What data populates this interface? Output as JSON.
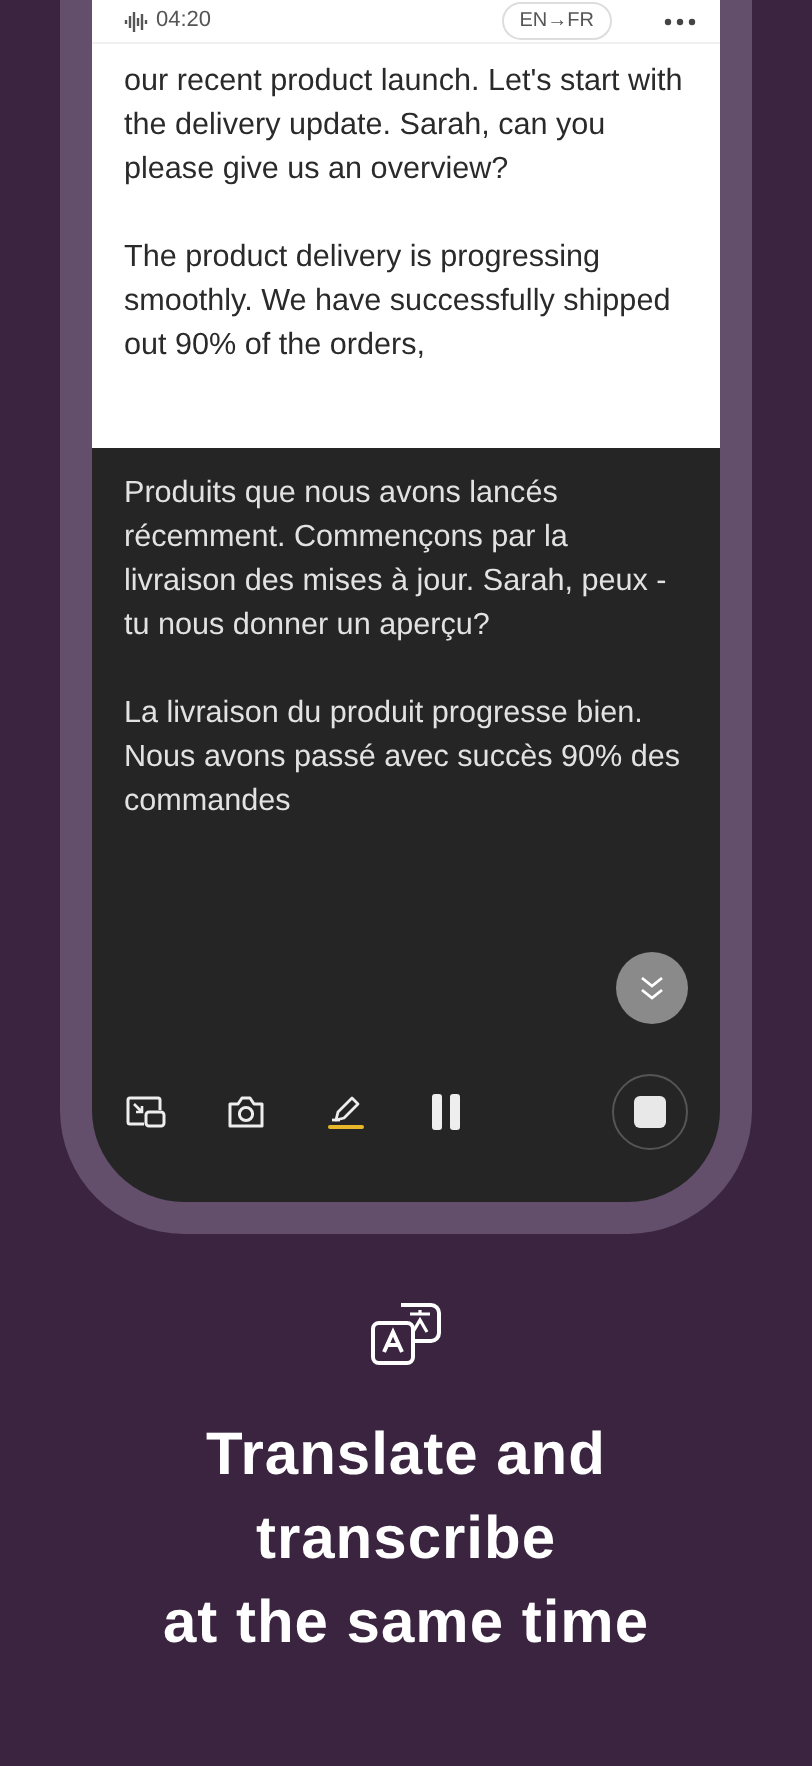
{
  "status": {
    "time": "04:20",
    "languages": "EN→FR"
  },
  "transcript": [
    "our recent product launch. Let's start with the delivery update. Sarah, can you please give us an overview?",
    "The product delivery is progressing smoothly. We have successfully shipped out 90% of the orders,"
  ],
  "translation": [
    "Produits que nous avons lancés récemment. Commençons par la livraison des mises à jour. Sarah, peux - tu nous donner un aperçu?",
    "La livraison du produit progresse bien. Nous avons passé avec succès 90% des commandes"
  ],
  "toolbar": [
    {
      "kind": "pip",
      "selected": false
    },
    {
      "kind": "camera",
      "selected": false
    },
    {
      "kind": "highlight",
      "selected": true
    },
    {
      "kind": "pause",
      "selected": false
    }
  ],
  "headline": "Translate and transcribe\nat the same time"
}
